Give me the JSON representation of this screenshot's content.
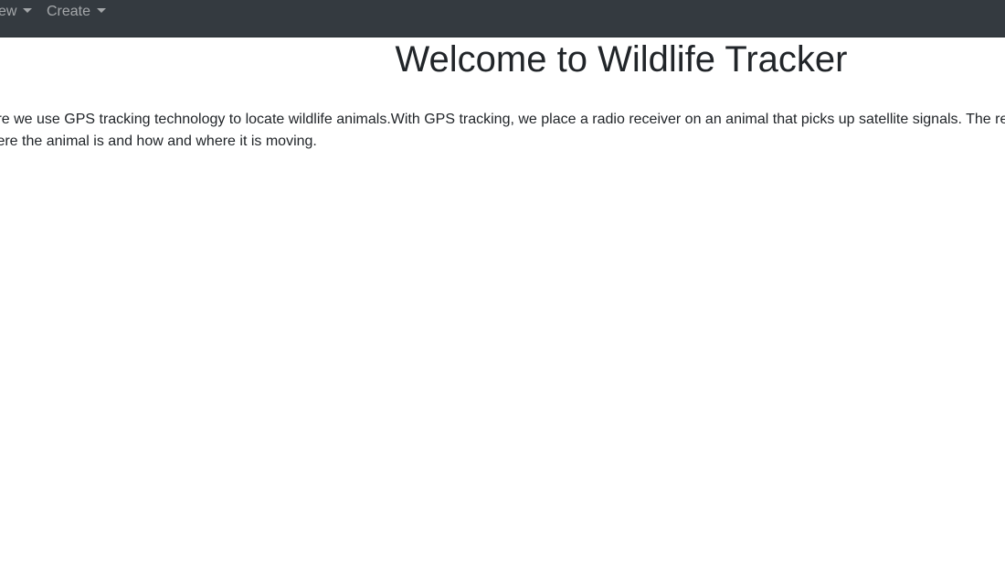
{
  "navbar": {
    "items": [
      {
        "label": "View"
      },
      {
        "label": "Create"
      }
    ]
  },
  "main": {
    "title": "Welcome to Wildlife Tracker",
    "intro_lines": [
      "Here we use GPS tracking technology to locate wildlife animals.With GPS tracking, we place a radio receiver on an animal that picks up satellite signals. The receiver",
      "where the animal is and how and where it is moving."
    ]
  },
  "colors": {
    "navbar_bg": "#343a40",
    "nav_text": "rgba(255,255,255,0.55)",
    "body_text": "#212529"
  }
}
